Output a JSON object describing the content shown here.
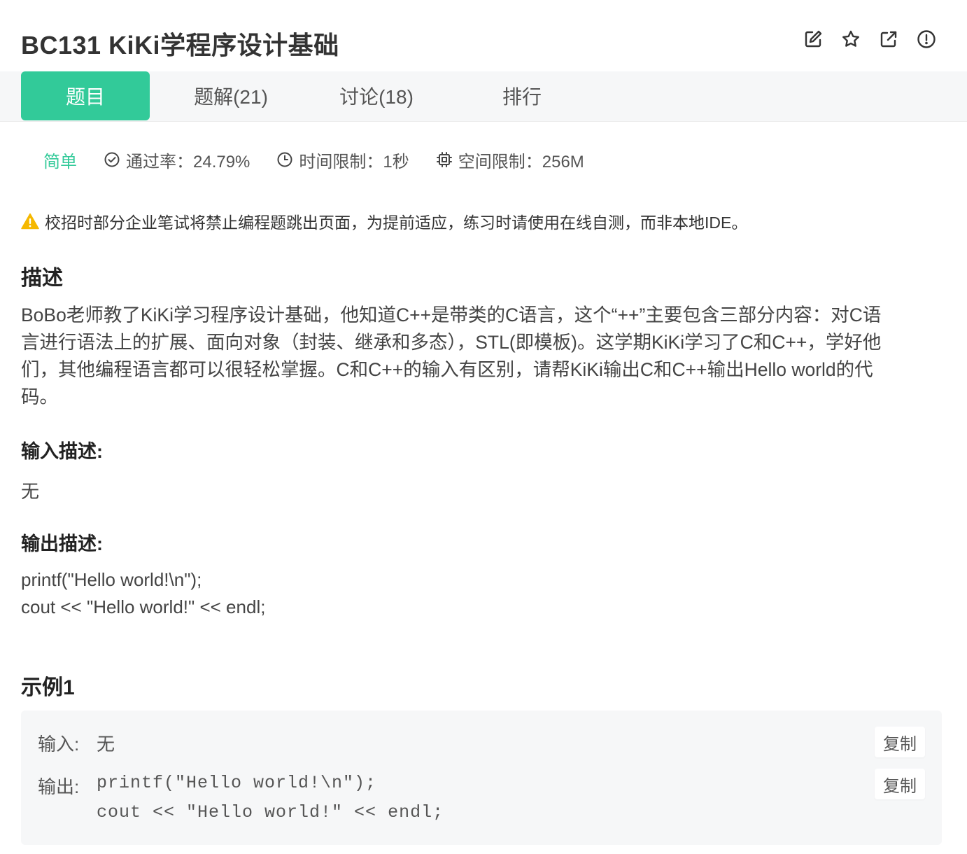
{
  "header": {
    "title": "BC131  KiKi学程序设计基础",
    "icons": [
      "edit-icon",
      "star-icon",
      "share-icon",
      "report-icon"
    ]
  },
  "tabs": [
    {
      "label": "题目",
      "active": true
    },
    {
      "label": "题解(21)",
      "active": false
    },
    {
      "label": "讨论(18)",
      "active": false
    },
    {
      "label": "排行",
      "active": false
    }
  ],
  "meta": {
    "difficulty": "简单",
    "pass_rate": "通过率：24.79%",
    "time_limit": "时间限制：1秒",
    "memory_limit": "空间限制：256M"
  },
  "warning": "校招时部分企业笔试将禁止编程题跳出页面，为提前适应，练习时请使用在线自测，而非本地IDE。",
  "description": {
    "title": "描述",
    "lines": [
      "BoBo老师教了KiKi学习程序设计基础，他知道C++是带类的C语言，这个“++”主要包含三部分内容：对C语",
      "言进行语法上的扩展、面向对象（封装、继承和多态），STL(即模板)。这学期KiKi学习了C和C++，学好他",
      "们，其他编程语言都可以很轻松掌握。C和C++的输入有区别，请帮KiKi输出C和C++输出Hello world的代",
      "码。"
    ]
  },
  "input": {
    "title": "输入描述:",
    "text": "无"
  },
  "output": {
    "title": "输出描述:",
    "line1": "printf(\"Hello world!\\n\");",
    "line2": "cout << \"Hello world!\" << endl;"
  },
  "example": {
    "title": "示例1",
    "input_label": "输入:",
    "input_value": "无",
    "output_label": "输出:",
    "output_line1": "printf(\"Hello world!\\n\");",
    "output_line2": "cout << \"Hello world!\" << endl;",
    "copy_label": "复制"
  },
  "colors": {
    "accent": "#32ca99",
    "warning": "#f5b800",
    "tab_bar_bg": "#f6f7f8"
  }
}
